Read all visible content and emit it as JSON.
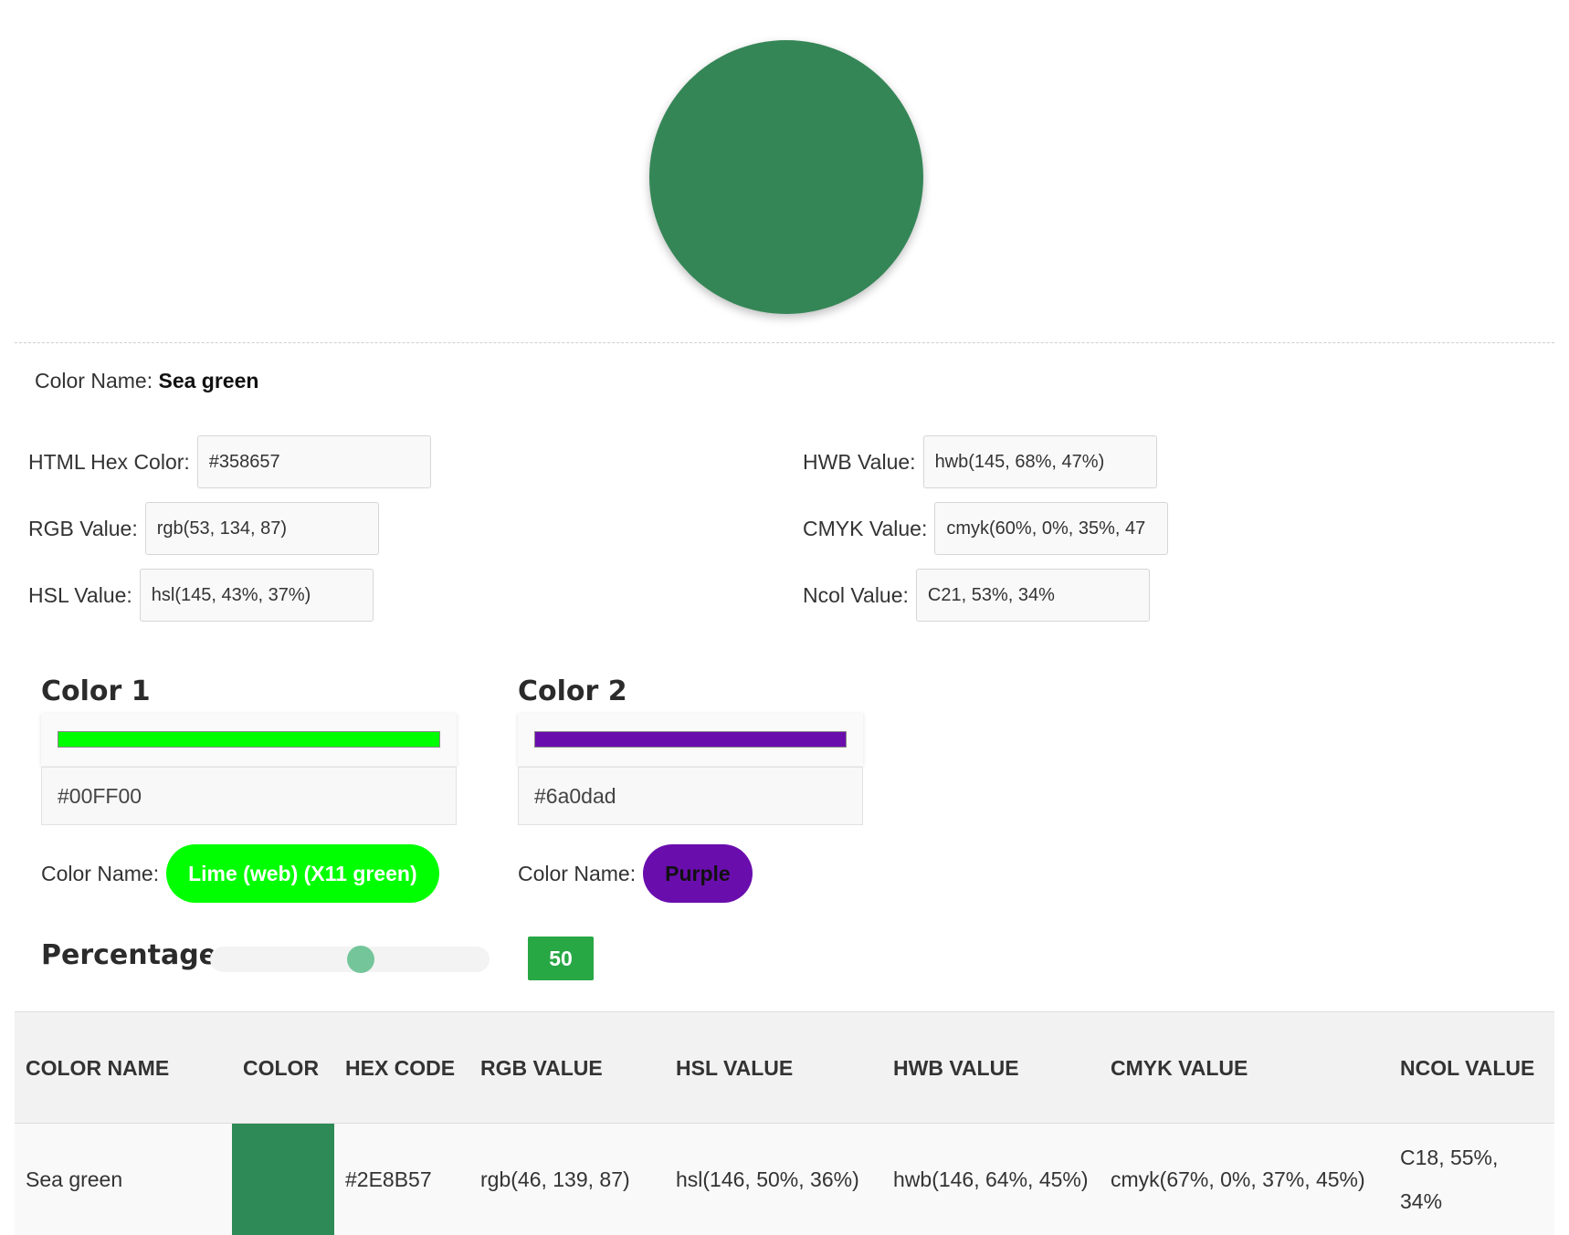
{
  "hero": {
    "color": "#358657"
  },
  "info": {
    "color_name_label": "Color Name: ",
    "color_name": "Sea green",
    "fields": [
      {
        "label": "HTML Hex Color:",
        "value": "#358657"
      },
      {
        "label": "RGB Value:",
        "value": "rgb(53, 134, 87)"
      },
      {
        "label": "HSL Value:",
        "value": "hsl(145, 43%, 37%)"
      },
      {
        "label": "HWB Value:",
        "value": "hwb(145, 68%, 47%)"
      },
      {
        "label": "CMYK Value:",
        "value": "cmyk(60%, 0%, 35%, 47"
      },
      {
        "label": "Ncol Value:",
        "value": "C21, 53%, 34%"
      }
    ]
  },
  "mixer": {
    "color1": {
      "title": "Color 1",
      "hex": "#00FF00",
      "swatch": "#00ff00",
      "name_label": "Color Name:",
      "name": "Lime (web) (X11 green)",
      "pill_bg": "#00ff00",
      "pill_fg": "#ffffff"
    },
    "color2": {
      "title": "Color 2",
      "hex": "#6a0dad",
      "swatch": "#6a0dad",
      "name_label": "Color Name:",
      "name": "Purple",
      "pill_bg": "#6a0dad",
      "pill_fg": "#111111"
    },
    "percentage_label": "Percentage",
    "percentage_value": "50",
    "percentage_fraction": 0.5
  },
  "table": {
    "headers": [
      "COLOR NAME",
      "COLOR",
      "HEX CODE",
      "RGB VALUE",
      "HSL VALUE",
      "HWB VALUE",
      "CMYK VALUE",
      "NCOL VALUE"
    ],
    "rows": [
      {
        "name": "Sea green",
        "swatch": "#2e8b57",
        "hex": "#2E8B57",
        "rgb": "rgb(46, 139, 87)",
        "hsl": "hsl(146, 50%, 36%)",
        "hwb": "hwb(146, 64%, 45%)",
        "cmyk": "cmyk(67%, 0%, 37%, 45%)",
        "ncol": "C18, 55%, 34%"
      }
    ]
  }
}
